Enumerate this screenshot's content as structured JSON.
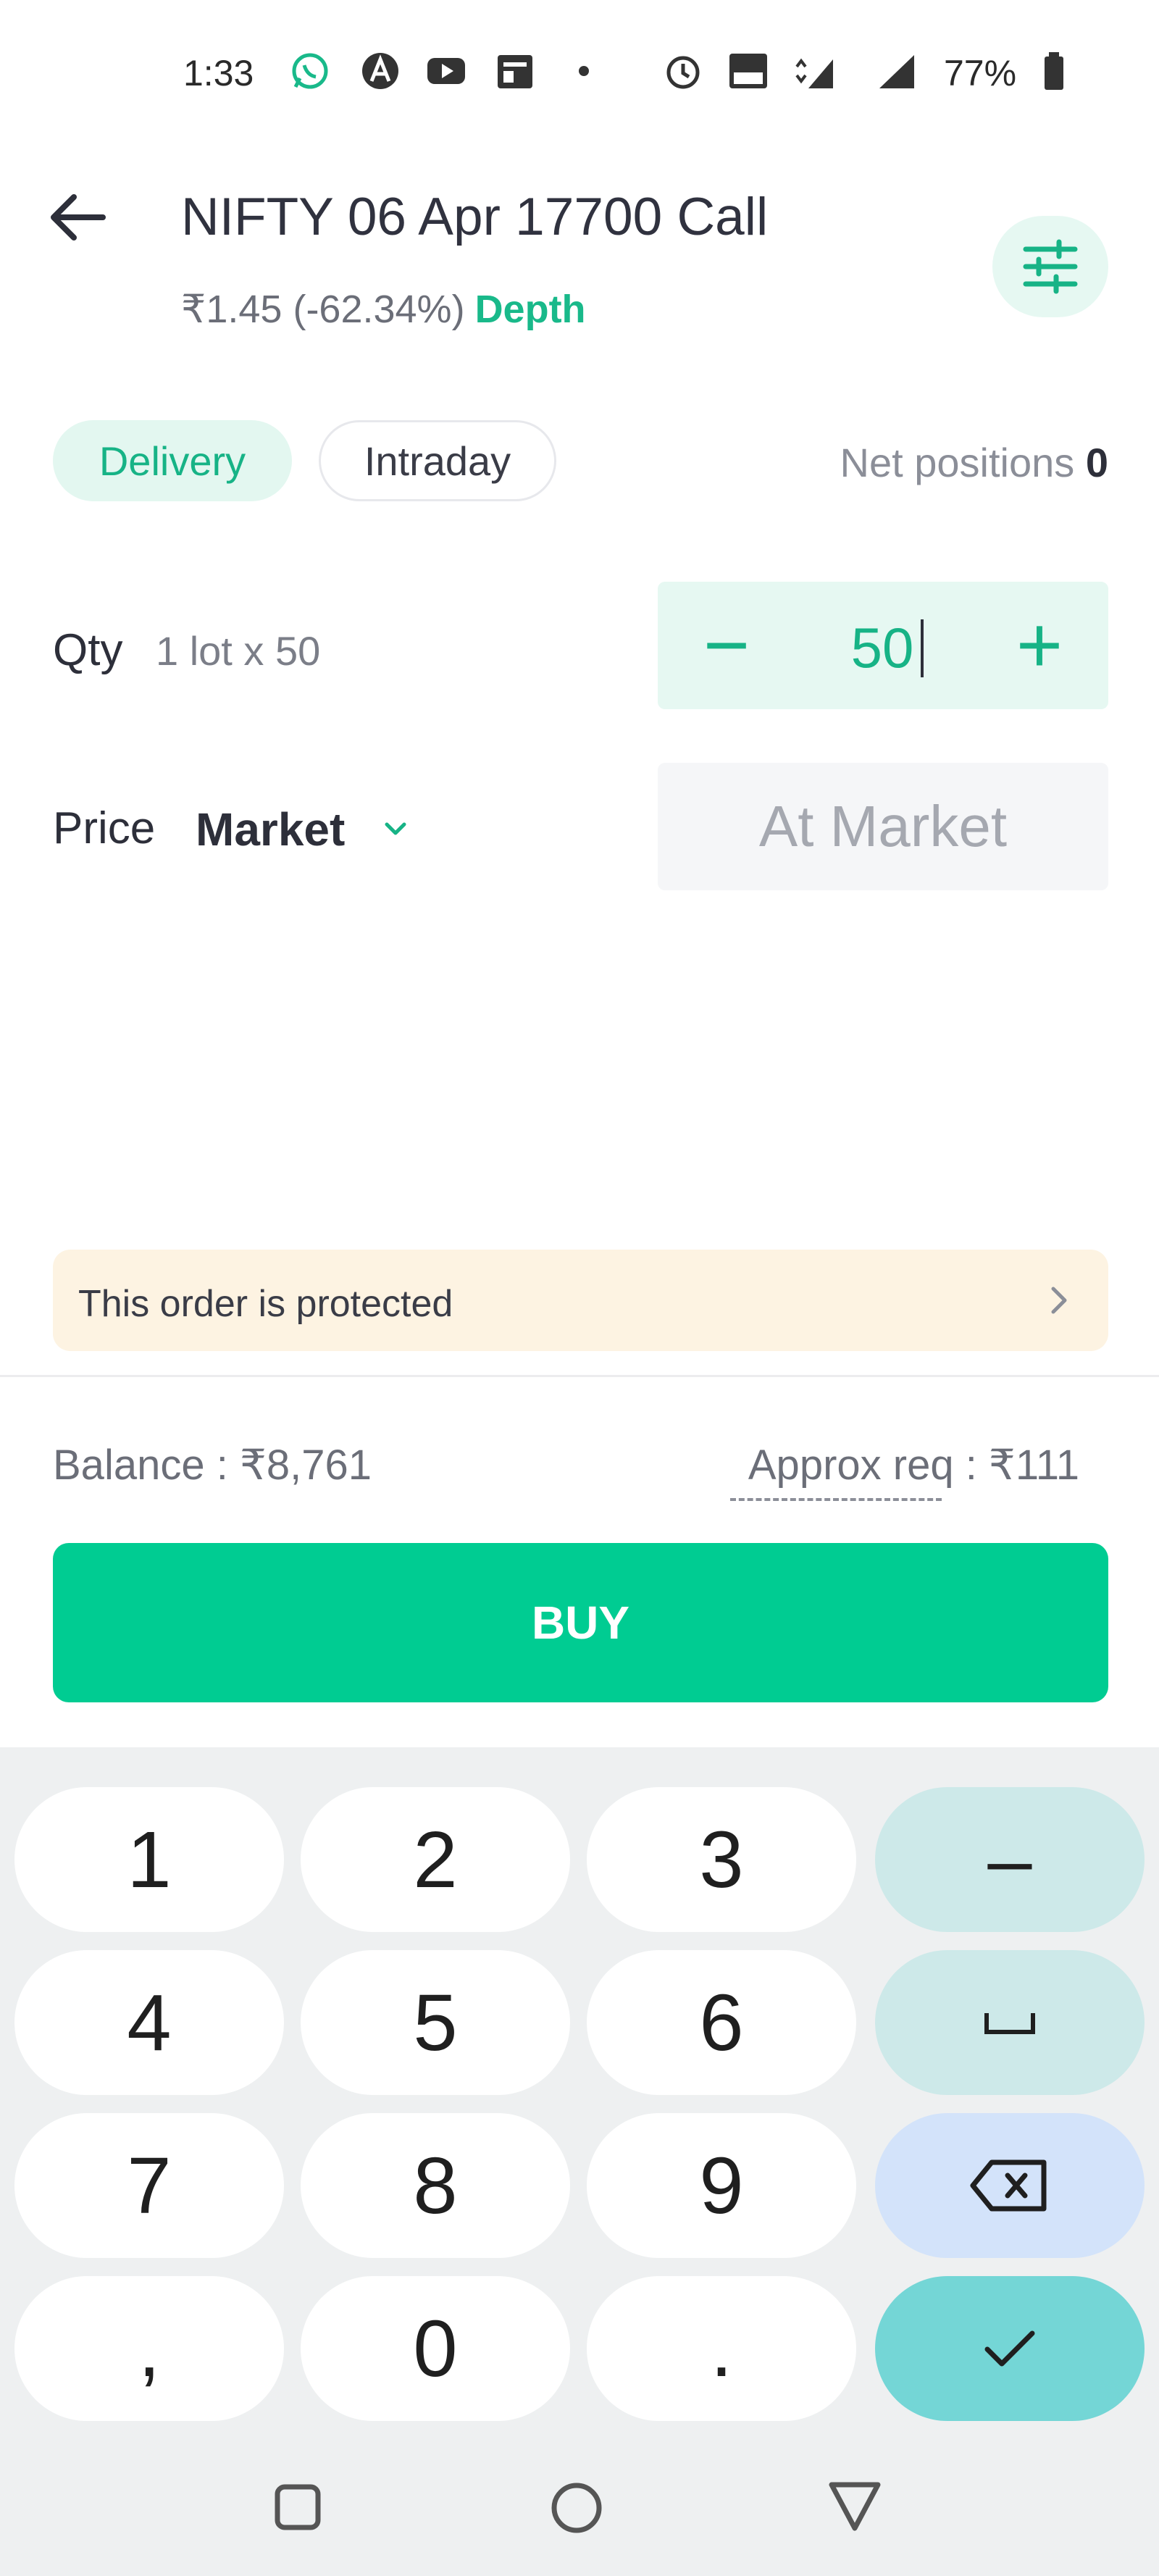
{
  "status_bar": {
    "time": "1:33",
    "battery": "77%",
    "icons": [
      "whatsapp-icon",
      "a-icon",
      "youtube-icon",
      "news-icon",
      "dot-icon",
      "alarm-icon",
      "volte-icon",
      "4g-icon",
      "signal-icon",
      "signal-icon",
      "battery-icon"
    ]
  },
  "header": {
    "title": "NIFTY 06 Apr 17700 Call",
    "price": "₹1.45 (-62.34%)",
    "depth_link": "Depth"
  },
  "product": {
    "delivery": "Delivery",
    "intraday": "Intraday",
    "selected": "Delivery",
    "net_positions_label": "Net positions",
    "net_positions_value": "0"
  },
  "qty": {
    "label": "Qty",
    "lot_text": "1 lot x 50",
    "minus": "−",
    "plus": "+",
    "value": "50"
  },
  "price": {
    "label": "Price",
    "type": "Market",
    "field": "At Market"
  },
  "banner": {
    "text": "This order is protected"
  },
  "summary": {
    "balance": "Balance : ₹8,761",
    "approx": "Approx req : ₹111"
  },
  "buy_button": "BUY",
  "keyboard": {
    "rows": [
      [
        "1",
        "2",
        "3",
        "–"
      ],
      [
        "4",
        "5",
        "6",
        "␣"
      ],
      [
        "7",
        "8",
        "9",
        "⌫"
      ],
      [
        ",",
        "0",
        ".",
        "✓"
      ]
    ]
  },
  "colors": {
    "accent": "#00cc92",
    "accent_text": "#17b386",
    "banner_bg": "#fdf3e2"
  }
}
